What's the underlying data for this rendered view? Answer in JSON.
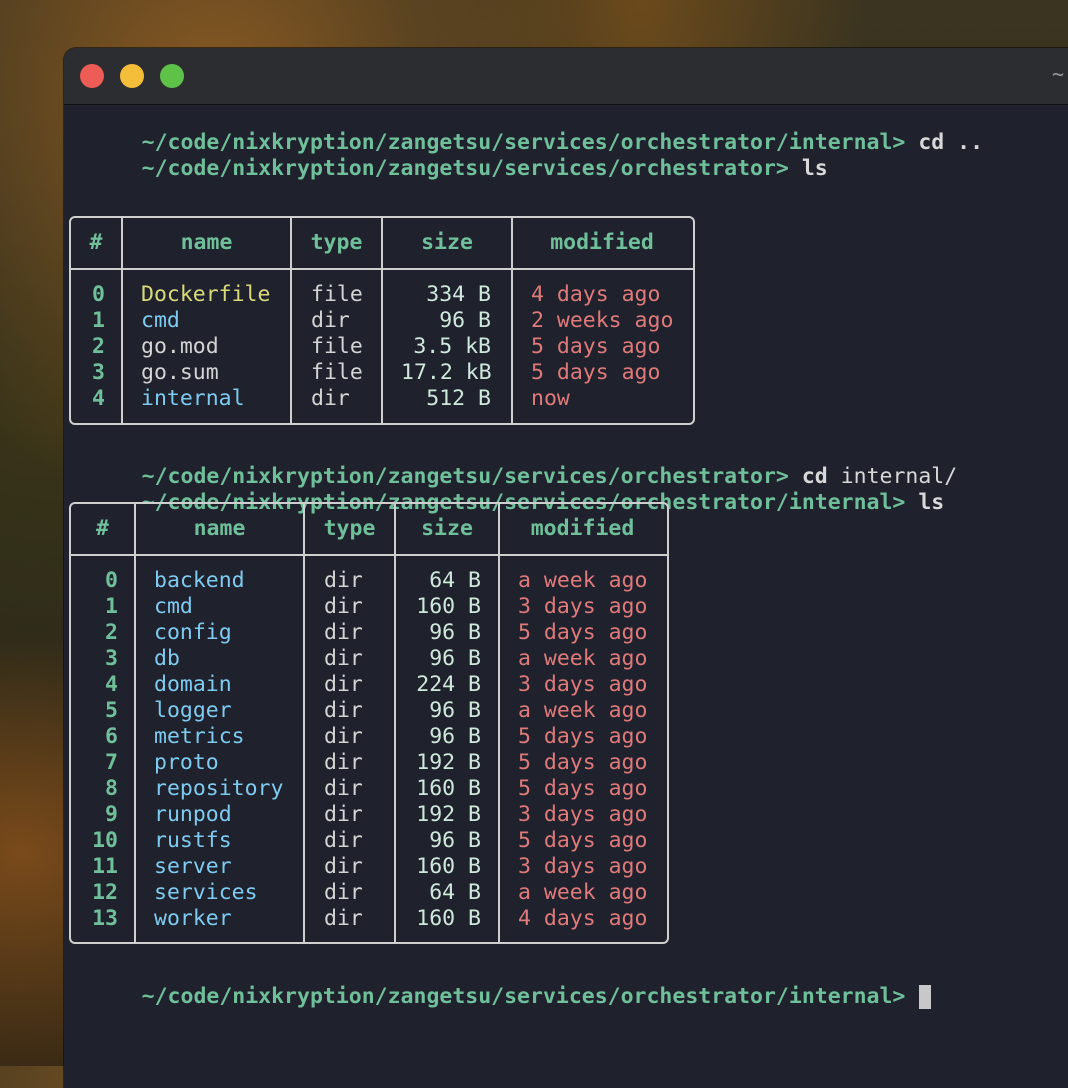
{
  "title_glyph": "~",
  "history": [
    {
      "prompt": "~/code/nixkryption/zangetsu/services/orchestrator/internal>",
      "command": "cd",
      "args": ".."
    },
    {
      "prompt": "~/code/nixkryption/zangetsu/services/orchestrator>",
      "command": "ls",
      "args": ""
    },
    {
      "prompt": "~/code/nixkryption/zangetsu/services/orchestrator>",
      "command": "cd",
      "args": "internal/"
    },
    {
      "prompt": "~/code/nixkryption/zangetsu/services/orchestrator/internal>",
      "command": "ls",
      "args": ""
    },
    {
      "prompt": "~/code/nixkryption/zangetsu/services/orchestrator/internal>",
      "command": "",
      "args": ""
    }
  ],
  "table_headers": [
    "#",
    "name",
    "type",
    "size",
    "modified"
  ],
  "table1": [
    {
      "idx": "0",
      "name": "Dockerfile",
      "kind": "docker",
      "type": "file",
      "size": "334 B",
      "modified": "4 days ago"
    },
    {
      "idx": "1",
      "name": "cmd",
      "kind": "dir",
      "type": "dir",
      "size": "96 B",
      "modified": "2 weeks ago"
    },
    {
      "idx": "2",
      "name": "go.mod",
      "kind": "file",
      "type": "file",
      "size": "3.5 kB",
      "modified": "5 days ago"
    },
    {
      "idx": "3",
      "name": "go.sum",
      "kind": "file",
      "type": "file",
      "size": "17.2 kB",
      "modified": "5 days ago"
    },
    {
      "idx": "4",
      "name": "internal",
      "kind": "dir",
      "type": "dir",
      "size": "512 B",
      "modified": "now"
    }
  ],
  "table2": [
    {
      "idx": "0",
      "name": "backend",
      "kind": "dir",
      "type": "dir",
      "size": "64 B",
      "modified": "a week ago"
    },
    {
      "idx": "1",
      "name": "cmd",
      "kind": "dir",
      "type": "dir",
      "size": "160 B",
      "modified": "3 days ago"
    },
    {
      "idx": "2",
      "name": "config",
      "kind": "dir",
      "type": "dir",
      "size": "96 B",
      "modified": "5 days ago"
    },
    {
      "idx": "3",
      "name": "db",
      "kind": "dir",
      "type": "dir",
      "size": "96 B",
      "modified": "a week ago"
    },
    {
      "idx": "4",
      "name": "domain",
      "kind": "dir",
      "type": "dir",
      "size": "224 B",
      "modified": "3 days ago"
    },
    {
      "idx": "5",
      "name": "logger",
      "kind": "dir",
      "type": "dir",
      "size": "96 B",
      "modified": "a week ago"
    },
    {
      "idx": "6",
      "name": "metrics",
      "kind": "dir",
      "type": "dir",
      "size": "96 B",
      "modified": "5 days ago"
    },
    {
      "idx": "7",
      "name": "proto",
      "kind": "dir",
      "type": "dir",
      "size": "192 B",
      "modified": "5 days ago"
    },
    {
      "idx": "8",
      "name": "repository",
      "kind": "dir",
      "type": "dir",
      "size": "160 B",
      "modified": "5 days ago"
    },
    {
      "idx": "9",
      "name": "runpod",
      "kind": "dir",
      "type": "dir",
      "size": "192 B",
      "modified": "3 days ago"
    },
    {
      "idx": "10",
      "name": "rustfs",
      "kind": "dir",
      "type": "dir",
      "size": "96 B",
      "modified": "5 days ago"
    },
    {
      "idx": "11",
      "name": "server",
      "kind": "dir",
      "type": "dir",
      "size": "160 B",
      "modified": "3 days ago"
    },
    {
      "idx": "12",
      "name": "services",
      "kind": "dir",
      "type": "dir",
      "size": "64 B",
      "modified": "a week ago"
    },
    {
      "idx": "13",
      "name": "worker",
      "kind": "dir",
      "type": "dir",
      "size": "160 B",
      "modified": "4 days ago"
    }
  ],
  "colors": {
    "prompt": "#6fbf9a",
    "dir": "#7ecbf2",
    "file": "#d4d4d4",
    "dockerfile": "#dada7a",
    "modified": "#e07a7a",
    "size": "#cfe8dc",
    "background": "#1f222c"
  }
}
